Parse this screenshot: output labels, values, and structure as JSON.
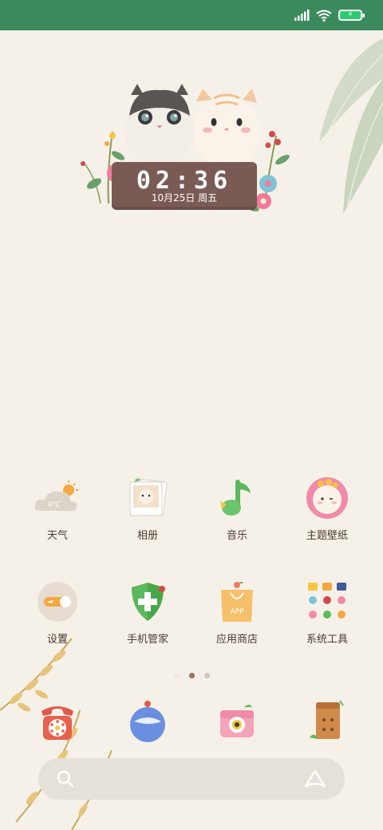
{
  "status_bar": {
    "signal_icon": "signal-bars-icon",
    "wifi_icon": "wifi-icon",
    "battery_icon": "battery-charging-icon"
  },
  "clock_widget": {
    "time": "02:36",
    "date": "10月25日 周五"
  },
  "apps_row1": [
    {
      "label": "天气",
      "icon": "weather-icon"
    },
    {
      "label": "相册",
      "icon": "gallery-icon"
    },
    {
      "label": "音乐",
      "icon": "music-icon"
    },
    {
      "label": "主题壁纸",
      "icon": "theme-wallpaper-icon"
    }
  ],
  "apps_row2": [
    {
      "label": "设置",
      "icon": "settings-icon"
    },
    {
      "label": "手机管家",
      "icon": "security-icon"
    },
    {
      "label": "应用商店",
      "icon": "app-store-icon"
    },
    {
      "label": "系统工具",
      "icon": "system-tools-icon"
    }
  ],
  "weather_badge": "0℃",
  "app_store_badge": "APP",
  "page_indicator": {
    "count": 3,
    "active": 1
  },
  "dock": [
    {
      "icon": "phone-icon"
    },
    {
      "icon": "browser-icon"
    },
    {
      "icon": "camera-icon"
    },
    {
      "icon": "file-manager-icon"
    }
  ],
  "search_bar": {
    "search_icon": "search-icon",
    "assistant_icon": "assistant-icon",
    "placeholder": ""
  },
  "colors": {
    "status_bar": "#3b8a5e",
    "background": "#f6f1e8",
    "plank": "#7a5a55",
    "dot_active": "#a86b5a",
    "dot_inactive": "#d9c4bb"
  }
}
